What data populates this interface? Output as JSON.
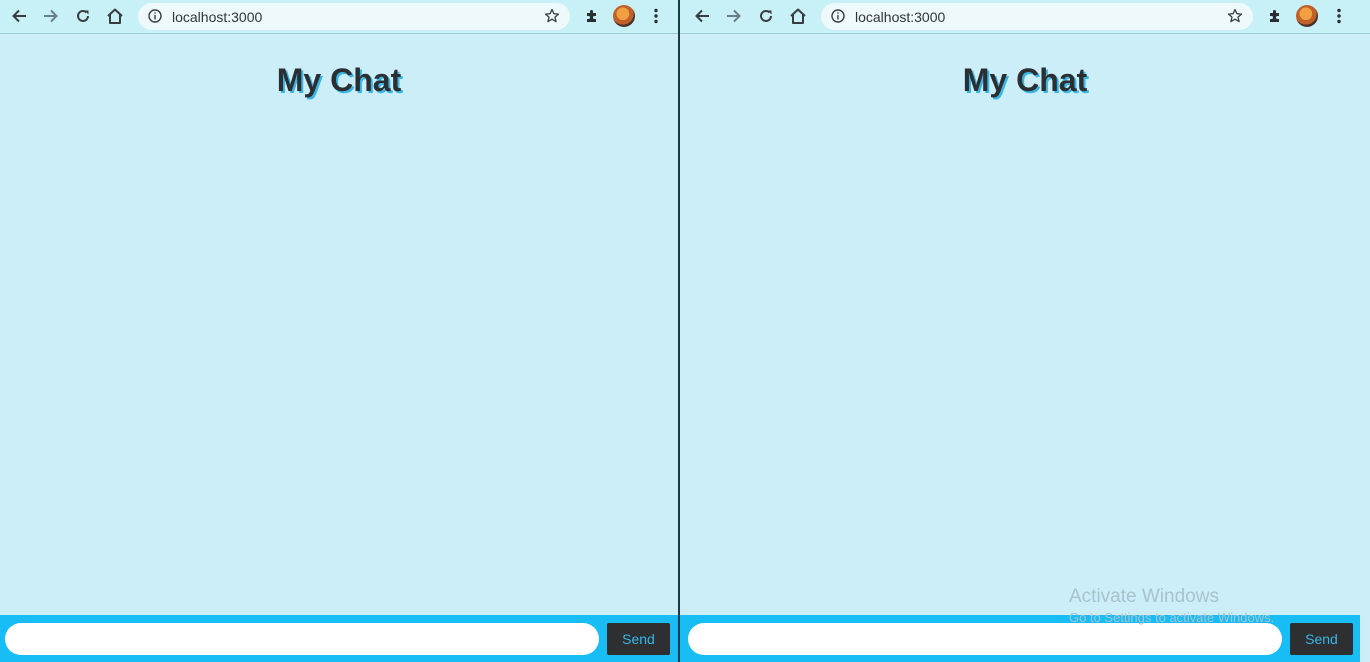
{
  "windows": [
    {
      "url": "localhost:3000",
      "page_title": "My Chat",
      "message_placeholder": "",
      "send_label": "Send"
    },
    {
      "url": "localhost:3000",
      "page_title": "My Chat",
      "message_placeholder": "",
      "send_label": "Send"
    }
  ],
  "watermark": {
    "title": "Activate Windows",
    "subtitle": "Go to Settings to activate Windows."
  },
  "colors": {
    "page_background": "#cbeef9",
    "toolbar_background": "#c8f0f7",
    "chatbar_background": "#17bdf4",
    "send_button": "#2e2f31",
    "send_text": "#3ab6e6"
  },
  "icons": [
    "back-icon",
    "forward-icon",
    "reload-icon",
    "home-icon",
    "info-icon",
    "bookmark-star-icon",
    "extensions-puzzle-icon",
    "profile-avatar",
    "menu-kebab-icon"
  ]
}
